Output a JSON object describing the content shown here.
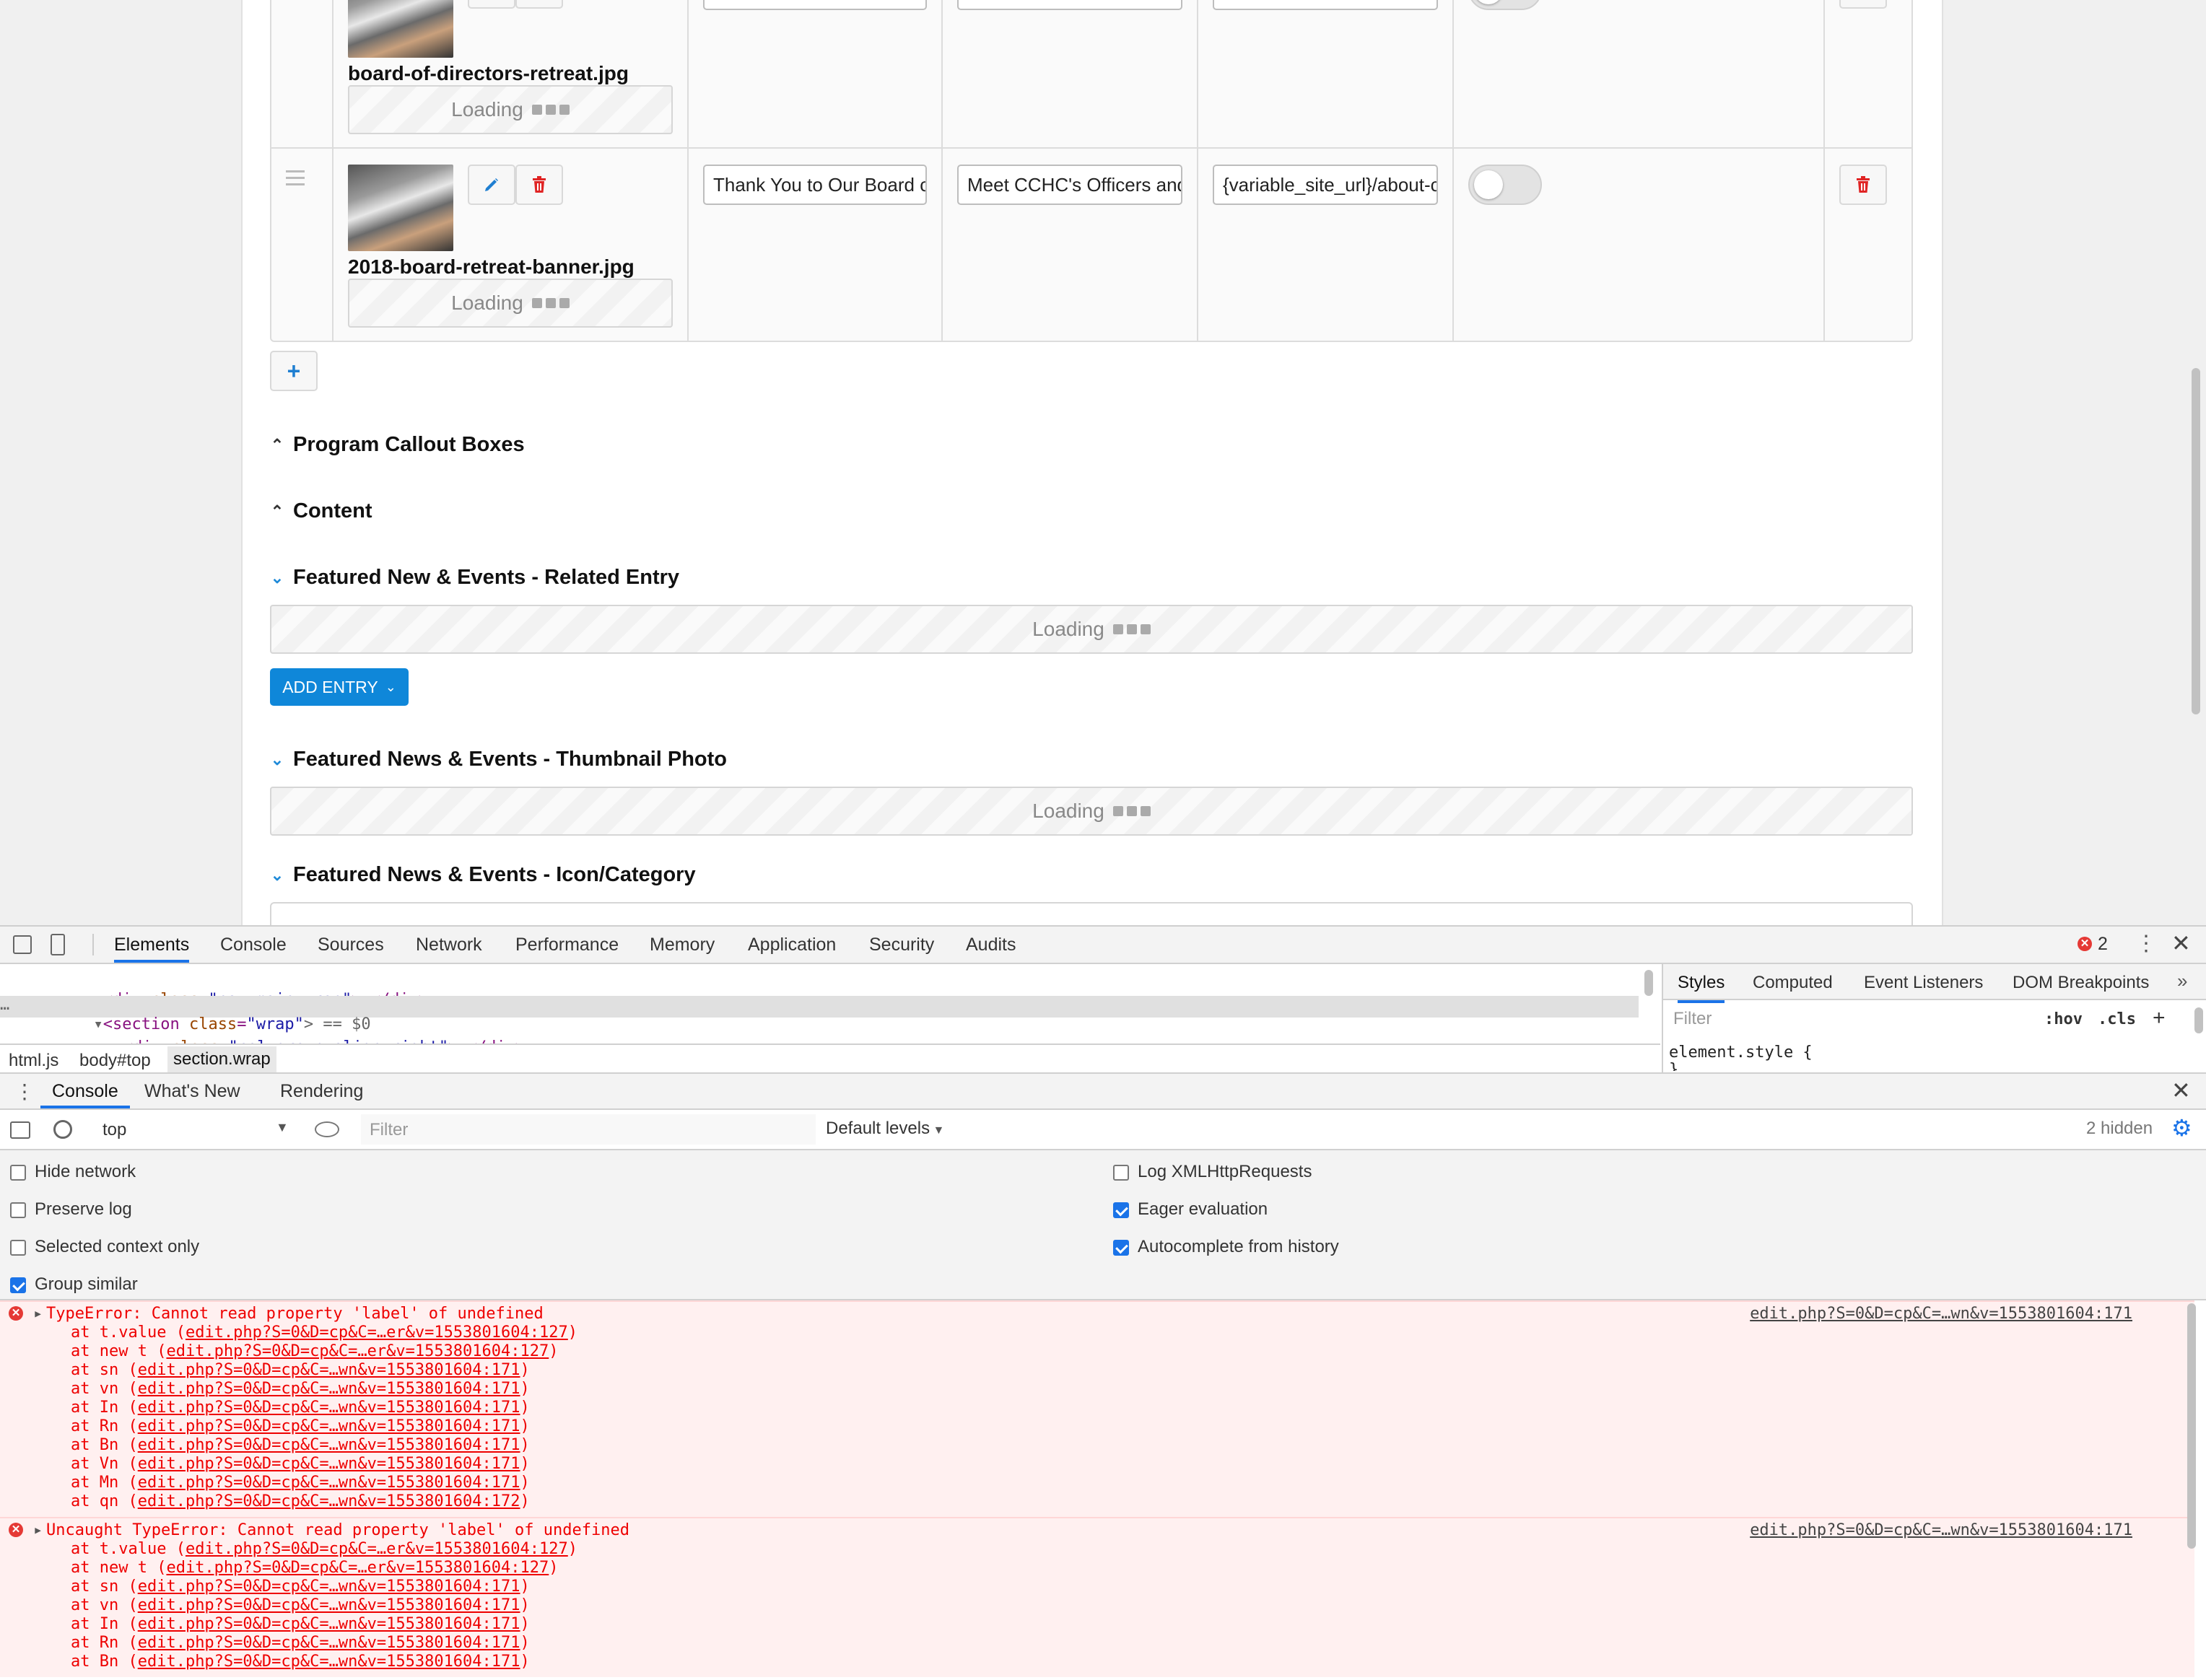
{
  "page": {
    "rows": [
      {
        "filename": "board-of-directors-retreat.jpg",
        "loading": "Loading"
      },
      {
        "filename": "2018-board-retreat-banner.jpg",
        "loading": "Loading",
        "title_value": "Thank You to Our Board c",
        "subtitle_value": "Meet CCHC's Officers and",
        "link_value": "{variable_site_url}/about-c"
      }
    ],
    "add_row_label": "+",
    "sections": [
      {
        "label": "Program Callout Boxes",
        "expanded": false
      },
      {
        "label": "Content",
        "expanded": false
      },
      {
        "label": "Featured New & Events - Related Entry",
        "expanded": true
      },
      {
        "label": "Featured News & Events - Thumbnail Photo",
        "expanded": true
      },
      {
        "label": "Featured News & Events - Icon/Category",
        "expanded": true
      }
    ],
    "related_loading": "Loading",
    "thumbnail_loading": "Loading",
    "add_entry_label": "ADD ENTRY"
  },
  "devtools": {
    "tabs": [
      "Elements",
      "Console",
      "Sources",
      "Network",
      "Performance",
      "Memory",
      "Application",
      "Security",
      "Audits"
    ],
    "active_tab": "Elements",
    "error_count": "2",
    "dom": {
      "line1": {
        "tag": "div",
        "class": "nav-main-wrap",
        "tail": ">…</div>"
      },
      "line2": {
        "tag": "section",
        "class": "wrap",
        "tail": "> == $0"
      },
      "line3": {
        "tag": "div",
        "class": "col-group align-right",
        "tail": ">…</div>"
      }
    },
    "breadcrumbs": [
      "html.js",
      "body#top",
      "section.wrap"
    ],
    "styles_tabs": [
      "Styles",
      "Computed",
      "Event Listeners",
      "DOM Breakpoints"
    ],
    "styles_filter_placeholder": "Filter",
    "hov": ":hov",
    "cls": ".cls",
    "element_style": "element.style {",
    "element_style_close": "}",
    "drawer_tabs": [
      "Console",
      "What's New",
      "Rendering"
    ],
    "context": "top",
    "console_filter_placeholder": "Filter",
    "default_levels": "Default levels",
    "hidden_count": "2 hidden",
    "settings_left": [
      {
        "label": "Hide network",
        "checked": false
      },
      {
        "label": "Preserve log",
        "checked": false
      },
      {
        "label": "Selected context only",
        "checked": false
      },
      {
        "label": "Group similar",
        "checked": true
      }
    ],
    "settings_right": [
      {
        "label": "Log XMLHttpRequests",
        "checked": false
      },
      {
        "label": "Eager evaluation",
        "checked": true
      },
      {
        "label": "Autocomplete from history",
        "checked": true
      }
    ],
    "errors": [
      {
        "message": "TypeError: Cannot read property 'label' of undefined",
        "source": "edit.php?S=0&D=cp&C=…wn&v=1553801604:171",
        "stack": [
          [
            "at t.value (",
            "edit.php?S=0&D=cp&C=…er&v=1553801604:127",
            ")"
          ],
          [
            "at new t (",
            "edit.php?S=0&D=cp&C=…er&v=1553801604:127",
            ")"
          ],
          [
            "at sn (",
            "edit.php?S=0&D=cp&C=…wn&v=1553801604:171",
            ")"
          ],
          [
            "at vn (",
            "edit.php?S=0&D=cp&C=…wn&v=1553801604:171",
            ")"
          ],
          [
            "at In (",
            "edit.php?S=0&D=cp&C=…wn&v=1553801604:171",
            ")"
          ],
          [
            "at Rn (",
            "edit.php?S=0&D=cp&C=…wn&v=1553801604:171",
            ")"
          ],
          [
            "at Bn (",
            "edit.php?S=0&D=cp&C=…wn&v=1553801604:171",
            ")"
          ],
          [
            "at Vn (",
            "edit.php?S=0&D=cp&C=…wn&v=1553801604:171",
            ")"
          ],
          [
            "at Mn (",
            "edit.php?S=0&D=cp&C=…wn&v=1553801604:171",
            ")"
          ],
          [
            "at qn (",
            "edit.php?S=0&D=cp&C=…wn&v=1553801604:172",
            ")"
          ]
        ]
      },
      {
        "message": "Uncaught TypeError: Cannot read property 'label' of undefined",
        "source": "edit.php?S=0&D=cp&C=…wn&v=1553801604:171",
        "stack": [
          [
            "at t.value (",
            "edit.php?S=0&D=cp&C=…er&v=1553801604:127",
            ")"
          ],
          [
            "at new t (",
            "edit.php?S=0&D=cp&C=…er&v=1553801604:127",
            ")"
          ],
          [
            "at sn (",
            "edit.php?S=0&D=cp&C=…wn&v=1553801604:171",
            ")"
          ],
          [
            "at vn (",
            "edit.php?S=0&D=cp&C=…wn&v=1553801604:171",
            ")"
          ],
          [
            "at In (",
            "edit.php?S=0&D=cp&C=…wn&v=1553801604:171",
            ")"
          ],
          [
            "at Rn (",
            "edit.php?S=0&D=cp&C=…wn&v=1553801604:171",
            ")"
          ],
          [
            "at Bn (",
            "edit.php?S=0&D=cp&C=…wn&v=1553801604:171",
            ")"
          ]
        ]
      }
    ]
  }
}
